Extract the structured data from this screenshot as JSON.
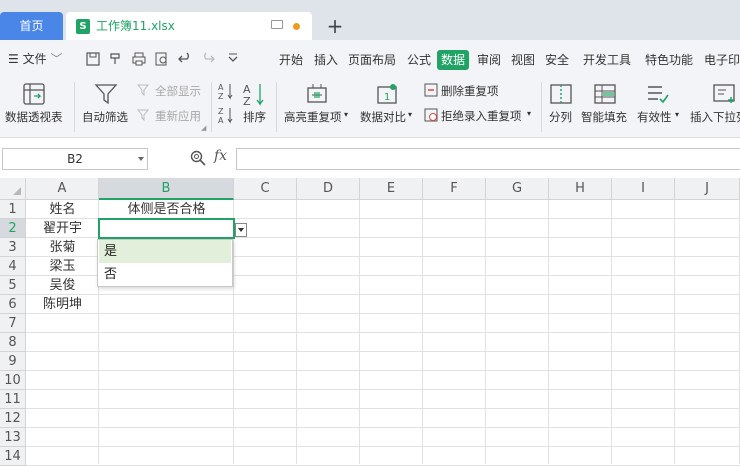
{
  "tabs": {
    "home": "首页",
    "document": "工作簿11.xlsx",
    "doc_badge": "S"
  },
  "menu": {
    "file": "文件",
    "items": [
      "开始",
      "插入",
      "页面布局",
      "公式",
      "数据",
      "审阅",
      "视图",
      "安全",
      "开发工具",
      "特色功能",
      "电子印"
    ],
    "active": "数据"
  },
  "ribbon": {
    "pivot": "数据透视表",
    "autofilter": "自动筛选",
    "show_all": "全部显示",
    "reapply": "重新应用",
    "sort": "排序",
    "highlight_dup": "高亮重复项",
    "compare": "数据对比",
    "remove_dup": "删除重复项",
    "reject_dup": "拒绝录入重复项",
    "split": "分列",
    "smart_fill": "智能填充",
    "validation": "有效性",
    "dropdown": "插入下拉列"
  },
  "formula_bar": {
    "name_box": "B2",
    "fx": "fx",
    "formula": ""
  },
  "sheet": {
    "columns": [
      "A",
      "B",
      "C",
      "D",
      "E",
      "F",
      "G",
      "H",
      "I",
      "J"
    ],
    "selected_column": "B",
    "rows": [
      "1",
      "2",
      "3",
      "4",
      "5",
      "6",
      "7",
      "8",
      "9",
      "10",
      "11",
      "12",
      "13",
      "14"
    ],
    "selected_row": "2",
    "cells": {
      "A1": "姓名",
      "B1": "体侧是否合格",
      "A2": "翟开宇",
      "A3": "张菊",
      "A4": "梁玉",
      "A5": "吴俊",
      "A6": "陈明坤"
    }
  },
  "dropdown_list": {
    "options": [
      "是",
      "否"
    ],
    "highlighted": "是"
  },
  "colors": {
    "accent": "#21a366",
    "home_tab": "#4a86e8"
  }
}
